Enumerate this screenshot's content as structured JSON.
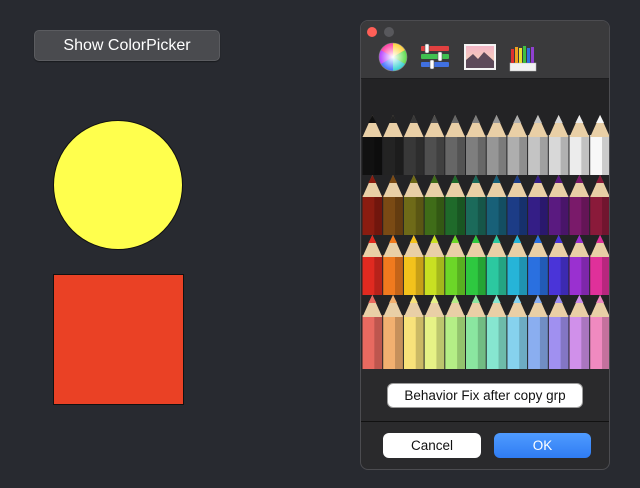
{
  "main": {
    "show_button_label": "Show ColorPicker",
    "circle_color": "#ffff4d",
    "square_color": "#ea4125"
  },
  "picker": {
    "toolbar": [
      {
        "name": "color-wheel-mode-icon"
      },
      {
        "name": "color-sliders-mode-icon"
      },
      {
        "name": "image-palettes-mode-icon"
      },
      {
        "name": "pencils-mode-icon"
      }
    ],
    "pencils": {
      "rows": [
        [
          "#111111",
          "#232323",
          "#383838",
          "#4f4f4f",
          "#666666",
          "#7e7e7e",
          "#969696",
          "#aeaeae",
          "#c4c4c4",
          "#d8d8d8",
          "#ececec",
          "#f8f8f8"
        ],
        [
          "#8a1c10",
          "#7a4a14",
          "#6e6a18",
          "#3f6c18",
          "#1f6a2a",
          "#1b6a5a",
          "#186078",
          "#1c3c86",
          "#341e86",
          "#5a1a80",
          "#7a1a6a",
          "#8a1a3a"
        ],
        [
          "#e02a20",
          "#f07a1e",
          "#f3c21c",
          "#c8e022",
          "#6cd728",
          "#2ec840",
          "#2cc8a0",
          "#26b4d8",
          "#2a70e0",
          "#4a34d8",
          "#9a30d0",
          "#e0309a"
        ],
        [
          "#e86a60",
          "#f2b070",
          "#f8e27a",
          "#e6f286",
          "#b4ee86",
          "#8ae6a0",
          "#86e6d0",
          "#86d2ee",
          "#8aaef0",
          "#a090f0",
          "#d090ea",
          "#f08ac0"
        ]
      ]
    },
    "name_field_value": "Behavior Fix after copy grp",
    "cancel_label": "Cancel",
    "ok_label": "OK"
  }
}
